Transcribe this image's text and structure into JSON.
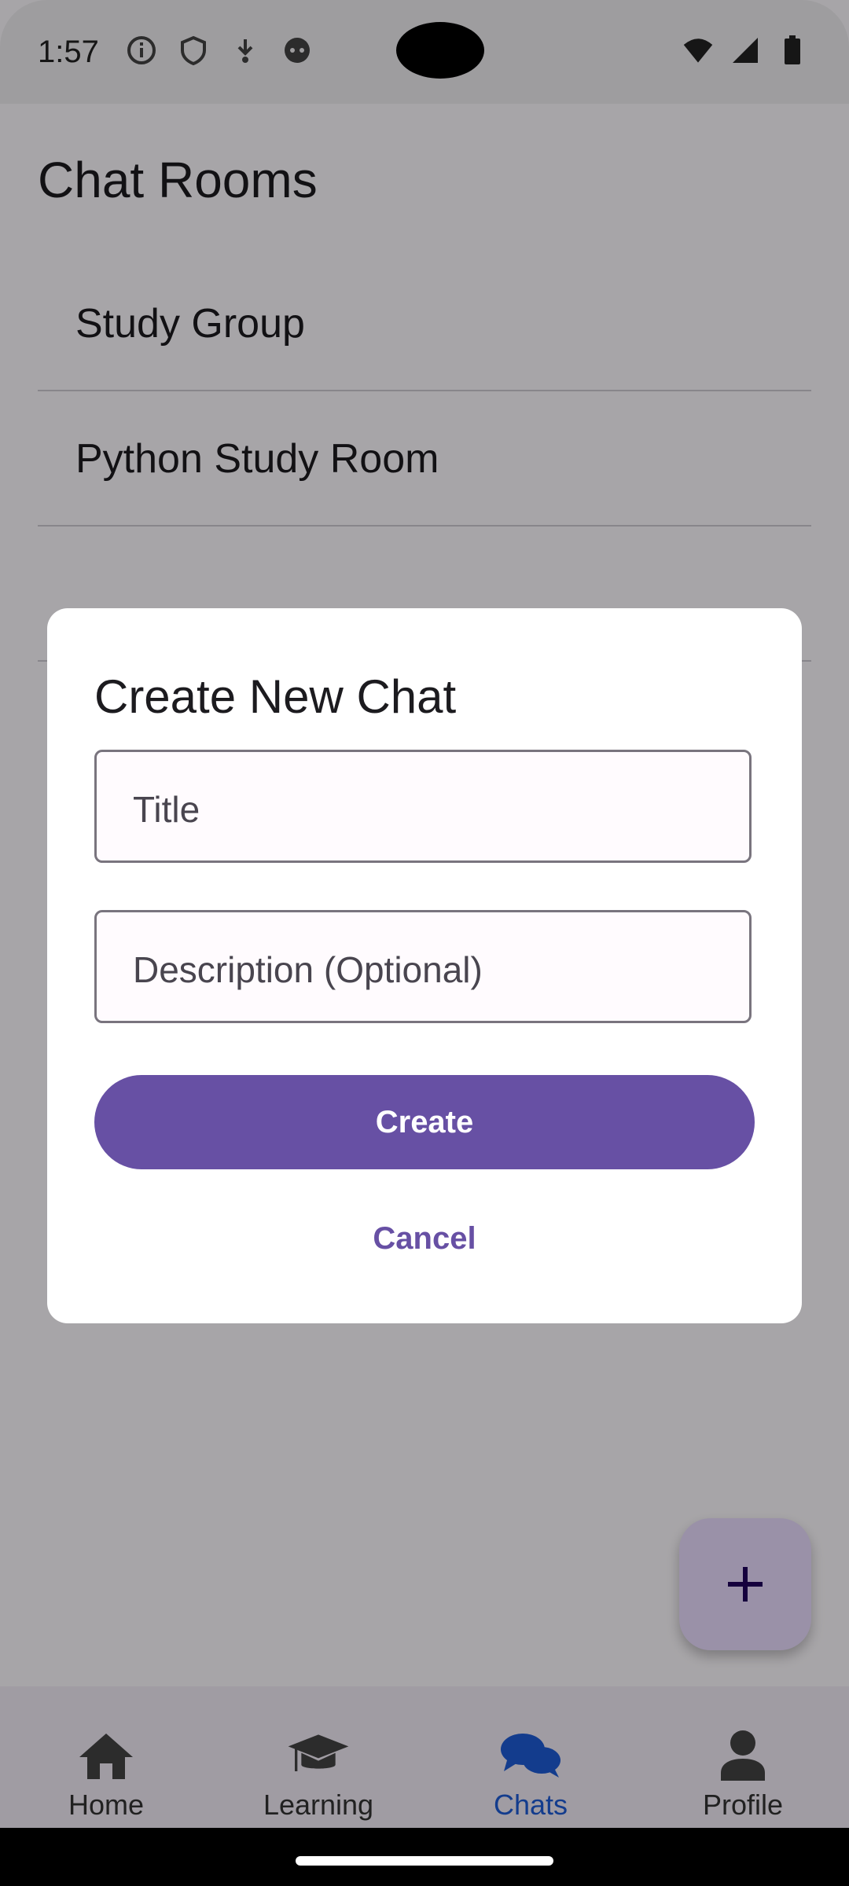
{
  "status_bar": {
    "time": "1:57"
  },
  "app_bar": {
    "title": "Chat Rooms"
  },
  "chat_rooms": [
    {
      "name": "Study Group"
    },
    {
      "name": "Python Study Room"
    },
    {
      "name": ""
    }
  ],
  "dialog": {
    "title": "Create New Chat",
    "title_field_placeholder": "Title",
    "description_field_placeholder": "Description (Optional)",
    "create_label": "Create",
    "cancel_label": "Cancel"
  },
  "bottom_nav": {
    "items": [
      {
        "label": "Home",
        "icon": "home-icon",
        "active": false
      },
      {
        "label": "Learning",
        "icon": "graduation-cap-icon",
        "active": false
      },
      {
        "label": "Chats",
        "icon": "chat-bubbles-icon",
        "active": true
      },
      {
        "label": "Profile",
        "icon": "person-icon",
        "active": false
      }
    ]
  },
  "colors": {
    "primary": "#6750a4",
    "active_nav": "#1e5bd6",
    "fab_bg": "#eaddff"
  }
}
